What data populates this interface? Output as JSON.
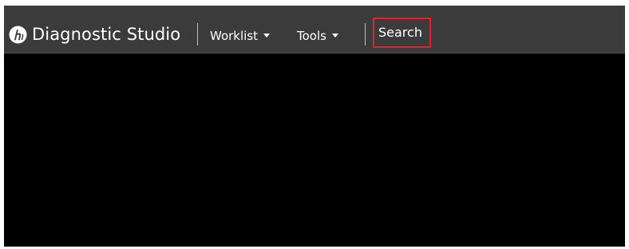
{
  "brand": {
    "logo_icon": "hp-logo-icon",
    "title": "Diagnostic Studio"
  },
  "nav": {
    "worklist_label": "Worklist",
    "tools_label": "Tools",
    "search_label": "Search"
  },
  "colors": {
    "navbar_bg": "#3b3b3b",
    "viewport_bg": "#000000",
    "highlight": "#d9262e",
    "text": "#ffffff"
  }
}
